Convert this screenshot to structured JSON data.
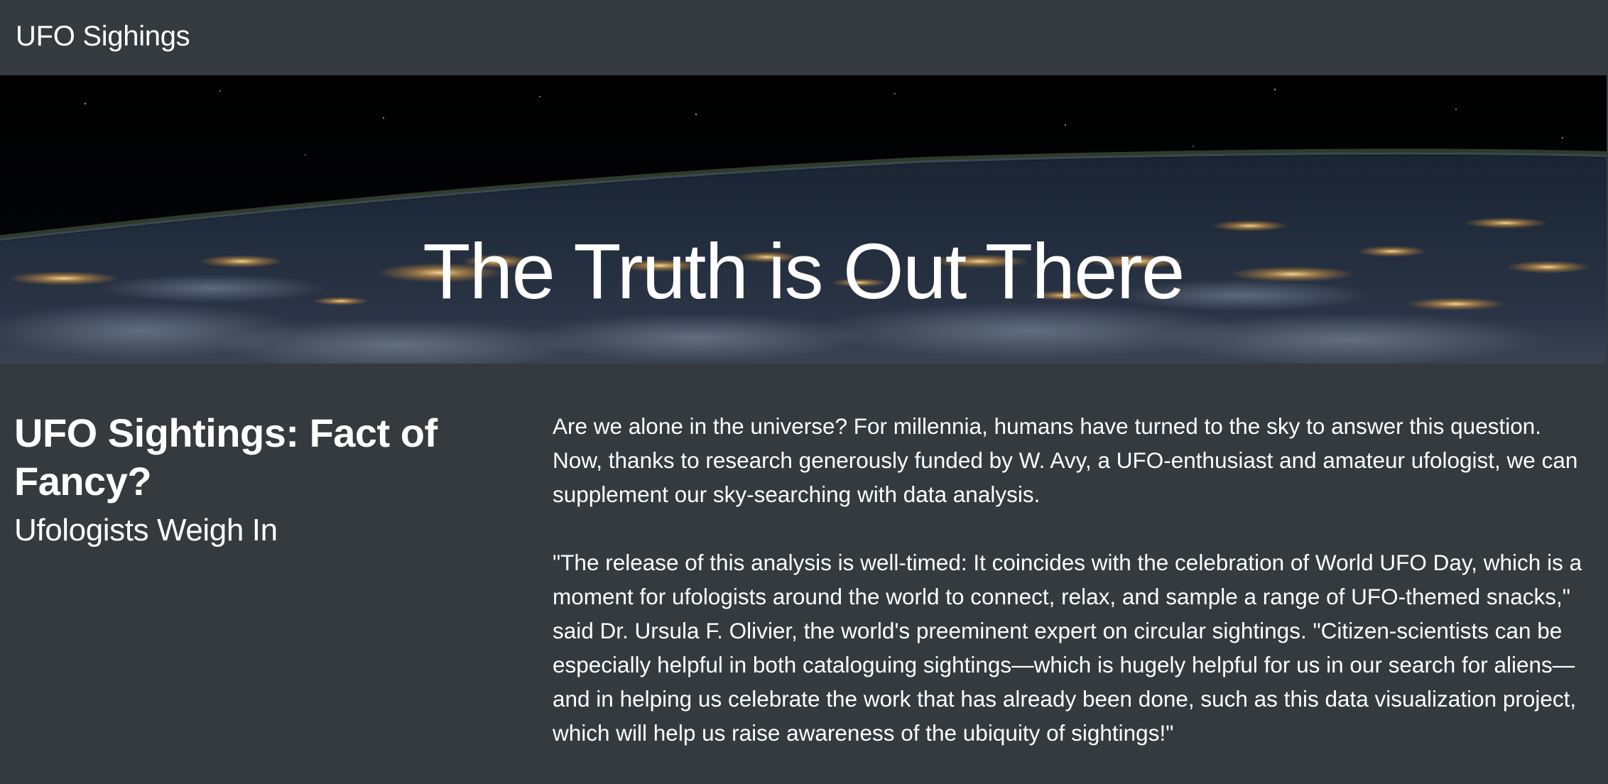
{
  "navbar": {
    "brand": "UFO Sighings"
  },
  "hero": {
    "title": "The Truth is Out There",
    "background_description_icon": "earth-night-from-space-image"
  },
  "intro": {
    "heading": "UFO Sightings: Fact of Fancy?",
    "subheading": "Ufologists Weigh In"
  },
  "article": {
    "paragraphs": [
      "Are we alone in the universe? For millennia, humans have turned to the sky to answer this question. Now, thanks to research generously funded by W. Avy, a UFO-enthusiast and amateur ufologist, we can supplement our sky-searching with data analysis.",
      "\"The release of this analysis is well-timed: It coincides with the celebration of World UFO Day, which is a moment for ufologists around the world to connect, relax, and sample a range of UFO-themed snacks,\" said Dr. Ursula F. Olivier, the world's preeminent expert on circular sightings. \"Citizen-scientists can be especially helpful in both cataloguing sightings—which is hugely helpful for us in our search for aliens—and in helping us celebrate the work that has already been done, such as this data visualization project, which will help us raise awareness of the ubiquity of sightings!\""
    ]
  },
  "colors": {
    "page_background": "#353a3f",
    "text": "#ffffff"
  }
}
